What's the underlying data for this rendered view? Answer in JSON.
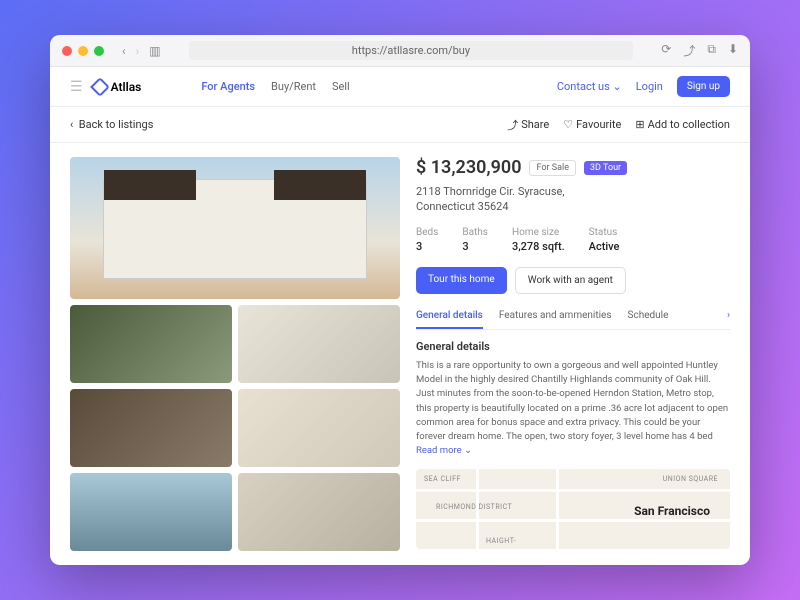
{
  "browser": {
    "url": "https://atllasre.com/buy"
  },
  "brand": "Atllas",
  "nav": {
    "for_agents": "For Agents",
    "buy_rent": "Buy/Rent",
    "sell": "Sell",
    "contact": "Contact us",
    "login": "Login",
    "signup": "Sign up"
  },
  "subbar": {
    "back": "Back to listings",
    "share": "Share",
    "favourite": "Favourite",
    "add_collection": "Add to collection"
  },
  "listing": {
    "price": "$ 13,230,900",
    "for_sale": "For Sale",
    "tour3d": "3D Tour",
    "address_line1": "2118 Thornridge Cir. Syracuse,",
    "address_line2": "Connecticut 35624",
    "stats": {
      "beds_label": "Beds",
      "beds": "3",
      "baths_label": "Baths",
      "baths": "3",
      "size_label": "Home size",
      "size": "3,278 sqft.",
      "status_label": "Status",
      "status": "Active"
    },
    "cta_tour": "Tour this home",
    "cta_agent": "Work with an agent",
    "tabs": {
      "general": "General details",
      "features": "Features and ammenities",
      "schedule": "Schedule"
    },
    "section_title": "General details",
    "description": "This is a rare opportunity to own a gorgeous and well appointed Huntley Model in the highly desired Chantilly Highlands community of Oak Hill. Just minutes from the soon-to-be-opened Herndon Station, Metro stop, this property is beautifully located on a prime .36 acre lot adjacent to open common area for bonus space and extra privacy. This could be your forever dream home. The open, two story foyer, 3 level home has 4 bed ",
    "read_more": "Read more",
    "map": {
      "city": "San Francisco",
      "n1": "SEA CLIFF",
      "n2": "RICHMOND DISTRICT",
      "n3": "UNION SQUARE",
      "n4": "HAIGHT-"
    }
  }
}
